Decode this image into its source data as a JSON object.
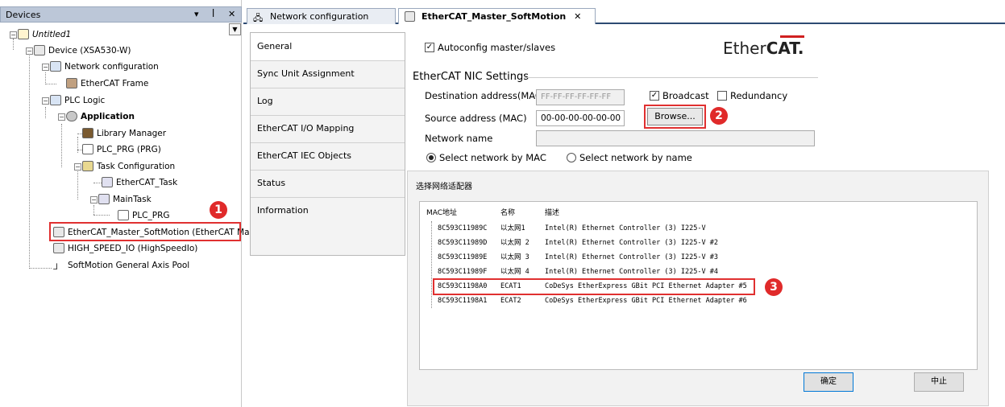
{
  "devices_panel": {
    "title": "Devices",
    "controls": [
      "▾",
      "ꟾ",
      "✕"
    ],
    "tree": [
      {
        "label": "Untitled1"
      },
      {
        "label": "Device (XSA530-W)"
      },
      {
        "label": "Network configuration"
      },
      {
        "label": "EtherCAT Frame"
      },
      {
        "label": "PLC Logic"
      },
      {
        "label": "Application"
      },
      {
        "label": "Library Manager"
      },
      {
        "label": "PLC_PRG (PRG)"
      },
      {
        "label": "Task Configuration"
      },
      {
        "label": "EtherCAT_Task"
      },
      {
        "label": "MainTask"
      },
      {
        "label": "PLC_PRG"
      },
      {
        "label": "EtherCAT_Master_SoftMotion (EtherCAT Mas"
      },
      {
        "label": "HIGH_SPEED_IO (HighSpeedIo)"
      },
      {
        "label": "SoftMotion General Axis Pool"
      }
    ]
  },
  "tabs": [
    {
      "label": "Network configuration"
    },
    {
      "label": "EtherCAT_Master_SoftMotion"
    }
  ],
  "tab_close": "✕",
  "side_tabs": [
    {
      "label": "General"
    },
    {
      "label": "Sync Unit Assignment"
    },
    {
      "label": "Log"
    },
    {
      "label": "EtherCAT I/O Mapping"
    },
    {
      "label": "EtherCAT IEC Objects"
    },
    {
      "label": "Status"
    },
    {
      "label": "Information"
    }
  ],
  "general": {
    "autoconfig": "Autoconfig master/slaves",
    "logo_a": "Ether",
    "logo_b": "CAT.",
    "nic_heading": "EtherCAT NIC Settings",
    "dest_label": "Destination address(MAC)",
    "dest_value": "FF-FF-FF-FF-FF-FF",
    "broadcast": "Broadcast",
    "redundancy": "Redundancy",
    "source_label": "Source address (MAC)",
    "source_value": "00-00-00-00-00-00",
    "browse": "Browse...",
    "network_name": "Network name",
    "by_mac": "Select network by MAC",
    "by_name": "Select network by name"
  },
  "dialog": {
    "title": "选择网络适配器",
    "columns": [
      "MAC地址",
      "名称",
      "描述"
    ],
    "rows": [
      [
        "8C593C11989C",
        "以太网1",
        "Intel(R) Ethernet Controller (3) I225-V"
      ],
      [
        "8C593C11989D",
        "以太网 2",
        "Intel(R) Ethernet Controller (3) I225-V #2"
      ],
      [
        "8C593C11989E",
        "以太网 3",
        "Intel(R) Ethernet Controller (3) I225-V #3"
      ],
      [
        "8C593C11989F",
        "以太网 4",
        "Intel(R) Ethernet Controller (3) I225-V #4"
      ],
      [
        "8C593C1198A0",
        "ECAT1",
        "CoDeSys EtherExpress GBit PCI Ethernet Adapter #5"
      ],
      [
        "8C593C1198A1",
        "ECAT2",
        "CoDeSys EtherExpress GBit PCI Ethernet Adapter #6"
      ]
    ],
    "ok": "确定",
    "cancel": "中止"
  },
  "markers": [
    "1",
    "2",
    "3"
  ],
  "colors": {
    "highlight": "#e03030",
    "header": "#bcc7d8",
    "tab_underline": "#2d4a72"
  }
}
